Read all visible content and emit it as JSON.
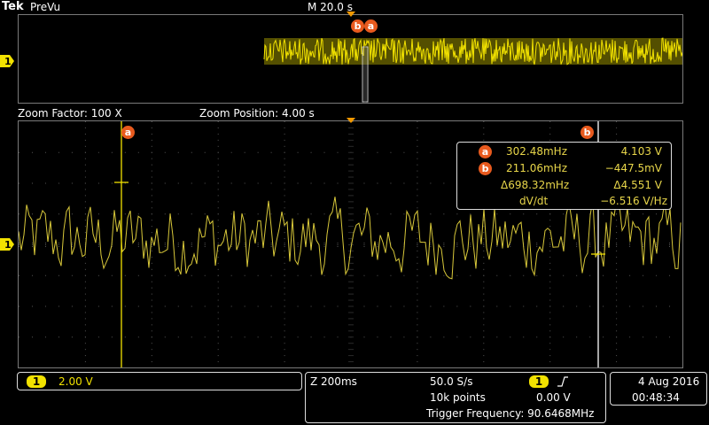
{
  "header": {
    "brand": "Tek",
    "mode": "PreVu",
    "horizontal_scale": "M 20.0 s"
  },
  "zoom": {
    "factor_label": "Zoom Factor: 100 X",
    "position_label": "Zoom Position: 4.00 s"
  },
  "cursors": {
    "a_label": "a",
    "b_label": "b",
    "a_freq": "302.48mHz",
    "a_volt": "4.103 V",
    "b_freq": "211.06mHz",
    "b_volt": "−447.5mV",
    "delta_freq": "Δ698.32mHz",
    "delta_volt": "Δ4.551 V",
    "slope_label": "dV/dt",
    "slope_value": "−6.516 V/Hz"
  },
  "channel": {
    "number": "1",
    "scale": "2.00 V",
    "color": "#f2e200"
  },
  "acquisition": {
    "zoom_scale": "Z 200ms",
    "sample_rate": "50.0 S/s",
    "record_length": "10k points",
    "trigger_source": "1",
    "trigger_slope_icon": "rising-edge-icon",
    "trigger_level": "0.00 V",
    "trigger_frequency": "Trigger Frequency: 90.6468MHz"
  },
  "datetime": {
    "date": "4 Aug 2016",
    "time": "00:48:34"
  }
}
